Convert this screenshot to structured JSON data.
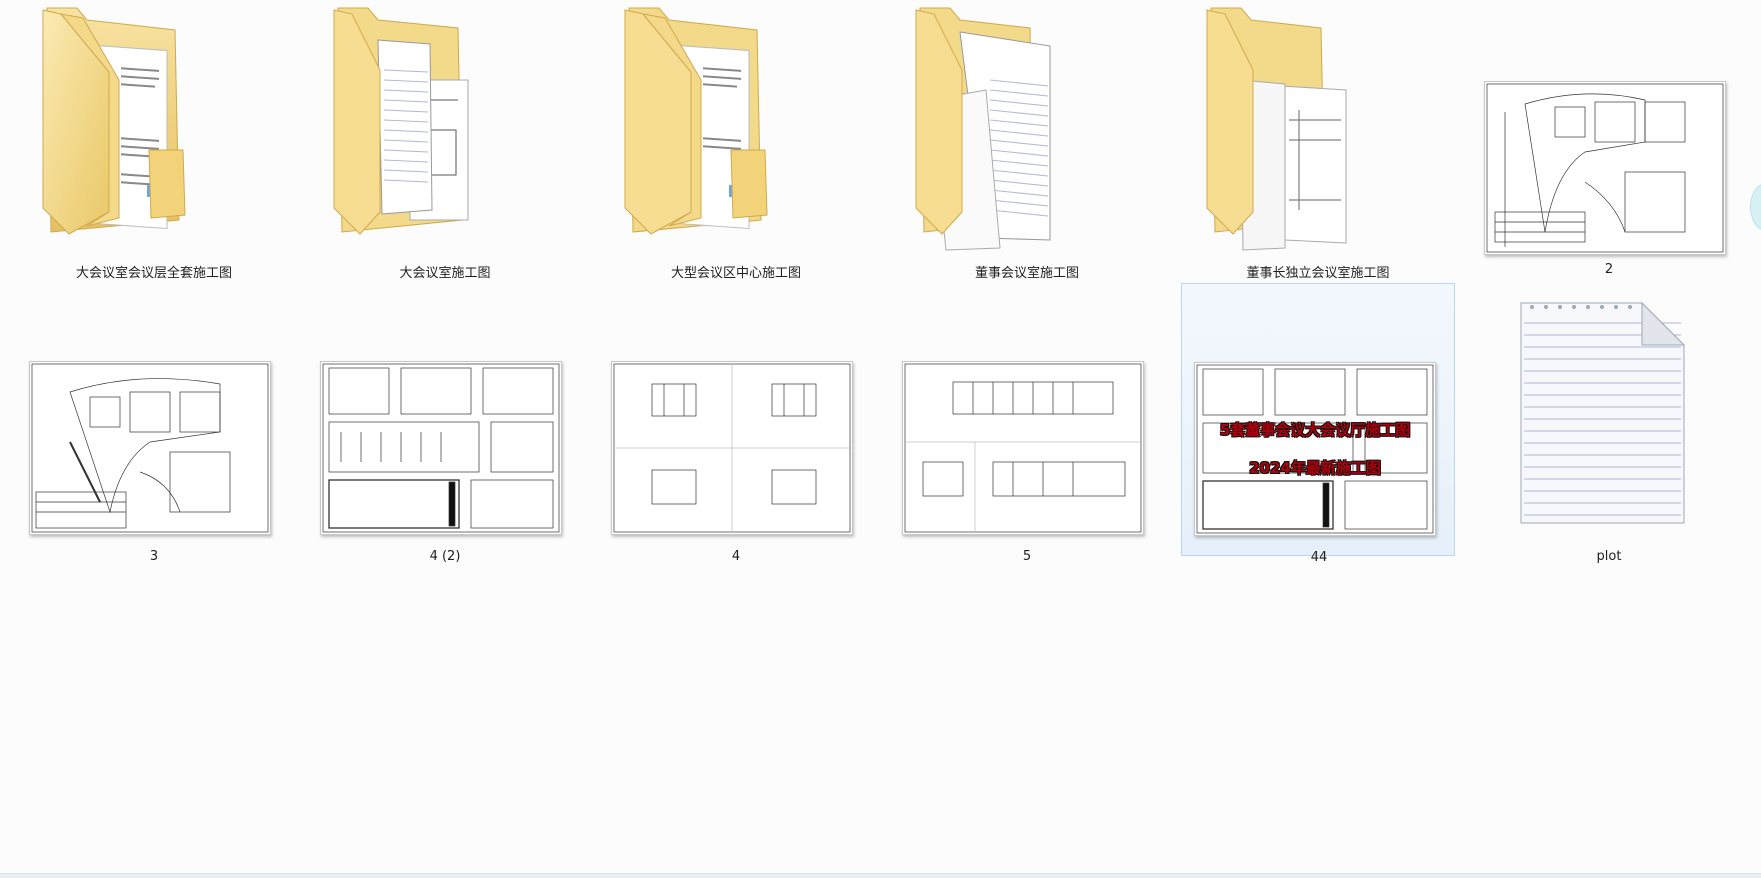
{
  "folders": [
    {
      "label": "大会议室会议层全套施工图",
      "icon": "folder-icon"
    },
    {
      "label": "大会议室施工图",
      "icon": "folder-icon"
    },
    {
      "label": "大型会议区中心施工图",
      "icon": "folder-icon"
    },
    {
      "label": "董事会议室施工图",
      "icon": "folder-icon"
    },
    {
      "label": "董事长独立会议室施工图",
      "icon": "folder-icon"
    }
  ],
  "files": [
    {
      "label": "2",
      "type": "image"
    },
    {
      "label": "3",
      "type": "image"
    },
    {
      "label": "4 (2)",
      "type": "image"
    },
    {
      "label": "4",
      "type": "image"
    },
    {
      "label": "5",
      "type": "image"
    },
    {
      "label": "44",
      "type": "image",
      "selected": true,
      "overlay_line1": "5套董事会议大会议厅施工图",
      "overlay_line2": "2024年最新施工图"
    },
    {
      "label": "plot",
      "type": "text-document"
    }
  ],
  "colors": {
    "background": "#fcfcfc",
    "selection_fill": "#e6f0fa",
    "selection_border": "#b9d5ef",
    "folder_yellow": "#f2d57a",
    "overlay_text": "#b0000e"
  }
}
